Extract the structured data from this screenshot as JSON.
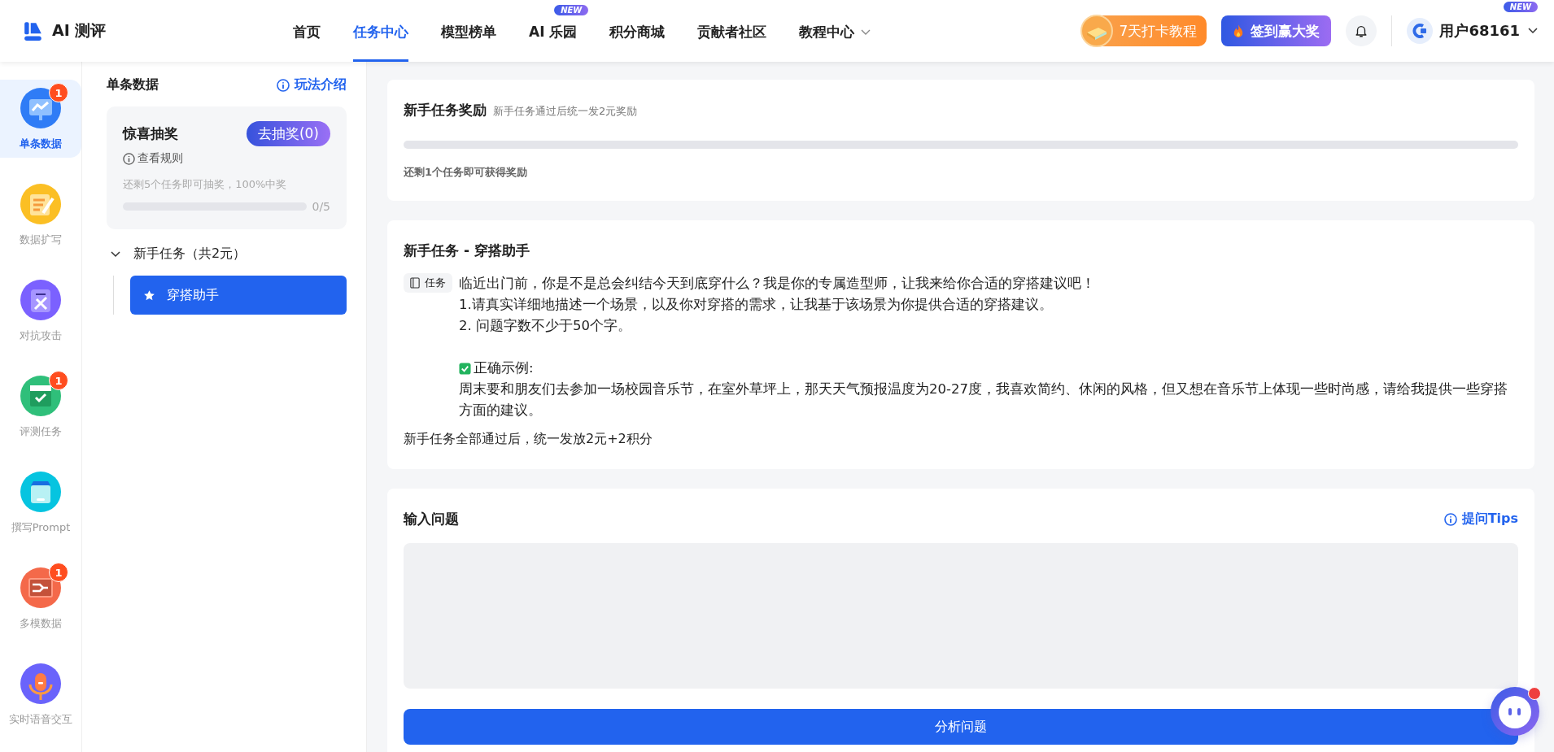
{
  "header": {
    "logo": "AI 测评",
    "nav": [
      {
        "label": "首页",
        "selected": false
      },
      {
        "label": "任务中心",
        "selected": true
      },
      {
        "label": "模型榜单",
        "selected": false
      },
      {
        "label": "AI 乐园",
        "selected": false,
        "badge": "NEW"
      },
      {
        "label": "积分商城",
        "selected": false
      },
      {
        "label": "贡献者社区",
        "selected": false
      },
      {
        "label": "教程中心",
        "selected": false,
        "dropdown": true
      }
    ],
    "tutorial_button": "7天打卡教程",
    "checkin_button": "签到赢大奖",
    "user": {
      "name": "用户68161",
      "badge": "NEW"
    }
  },
  "rail": [
    {
      "label": "单条数据",
      "selected": true,
      "badge": "1"
    },
    {
      "label": "数据扩写",
      "selected": false
    },
    {
      "label": "对抗攻击",
      "selected": false
    },
    {
      "label": "评测任务",
      "selected": false,
      "badge": "1"
    },
    {
      "label": "撰写Prompt",
      "selected": false
    },
    {
      "label": "多模数据",
      "selected": false,
      "badge": "1"
    },
    {
      "label": "实时语音交互",
      "selected": false
    }
  ],
  "panel": {
    "title": "单条数据",
    "help_link": "玩法介绍",
    "lottery": {
      "title": "惊喜抽奖",
      "button": "去抽奖(0)",
      "rules_link": "查看规则",
      "hint": "还剩5个任务即可抽奖，100%中奖",
      "level": 0,
      "count": "0/5"
    },
    "tree": [
      {
        "label": "新手任务（共2元）",
        "expanded": true,
        "children": [
          {
            "label": "穿搭助手",
            "selected": true
          }
        ]
      }
    ]
  },
  "reward_card": {
    "title": "新手任务奖励",
    "subtitle": "新手任务通过后统一发2元奖励",
    "level": 0,
    "note": "还剩1个任务即可获得奖励"
  },
  "task_card": {
    "title": "新手任务 - 穿搭助手",
    "tag": "任务",
    "lines": [
      {
        "kind": "line",
        "text": "临近出门前，你是不是总会纠结今天到底穿什么？我是你的专属造型师，让我来给你合适的穿搭建议吧！"
      },
      {
        "kind": "line",
        "text": "1.请真实详细地描述一个场景，以及你对穿搭的需求，让我基于该场景为你提供合适的穿搭建议。"
      },
      {
        "kind": "line",
        "text": "2. 问题字数不少于50个字。"
      },
      {
        "kind": "heading",
        "text": "正确示例:"
      },
      {
        "kind": "line",
        "text": "周末要和朋友们去参加一场校园音乐节，在室外草坪上，那天天气预报温度为20-27度，我喜欢简约、休闲的风格，但又想在音乐节上体现一些时尚感，请给我提供一些穿搭方面的建议。"
      }
    ],
    "footer": "新手任务全部通过后，统一发放2元+2积分"
  },
  "question_card": {
    "title": "输入问题",
    "tips_link": "提问Tips",
    "submit_button": "分析问题"
  }
}
